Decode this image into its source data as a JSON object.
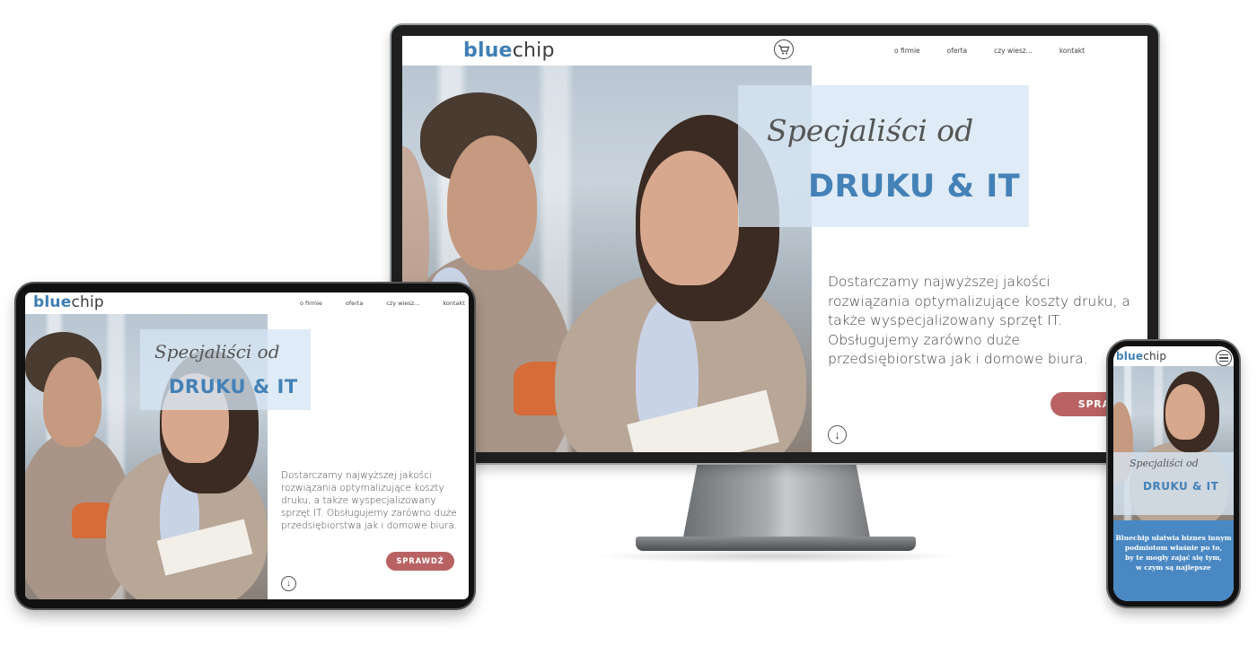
{
  "brand": {
    "logo_bold": "blue",
    "logo_rest": "chip"
  },
  "nav": [
    "o firmie",
    "oferta",
    "czy wiesz...",
    "kontakt"
  ],
  "hero": {
    "script_line": "Specjaliści od",
    "headline": "DRUKU & IT",
    "description_monitor": "Dostarczamy najwyższej jakości rozwiązania optymalizujące koszty druku, a także wyspecjalizowany sprzęt IT. Obsługujemy zarówno duże przedsiębiorstwa jak i domowe biura.",
    "description_tablet": "Dostarczamy najwyższej jakości rozwiązania optymalizujące koszty druku, a także wyspecjalizowany sprzęt IT. Obsługujemy zarówno duże przedsiębiorstwa jak i domowe biura.",
    "cta_monitor": "SPRAWD",
    "cta_tablet": "SPRAWDŹ",
    "down_arrow": "↓"
  },
  "phone": {
    "tagline_lines": [
      "Bluechip ułatwia biznes innym",
      "podmiotom właśnie po to,",
      "by te mogły zająć się tym,",
      "w czym są najlepsze"
    ]
  },
  "icons": {
    "cart": "cart-icon",
    "menu": "hamburger-menu-icon",
    "arrow": "arrow-down-icon"
  },
  "colors": {
    "brand_blue": "#3f7fb5",
    "cta_red": "#b96263",
    "hero_box": "#d6e5f4",
    "phone_blue": "#4a88c4"
  }
}
